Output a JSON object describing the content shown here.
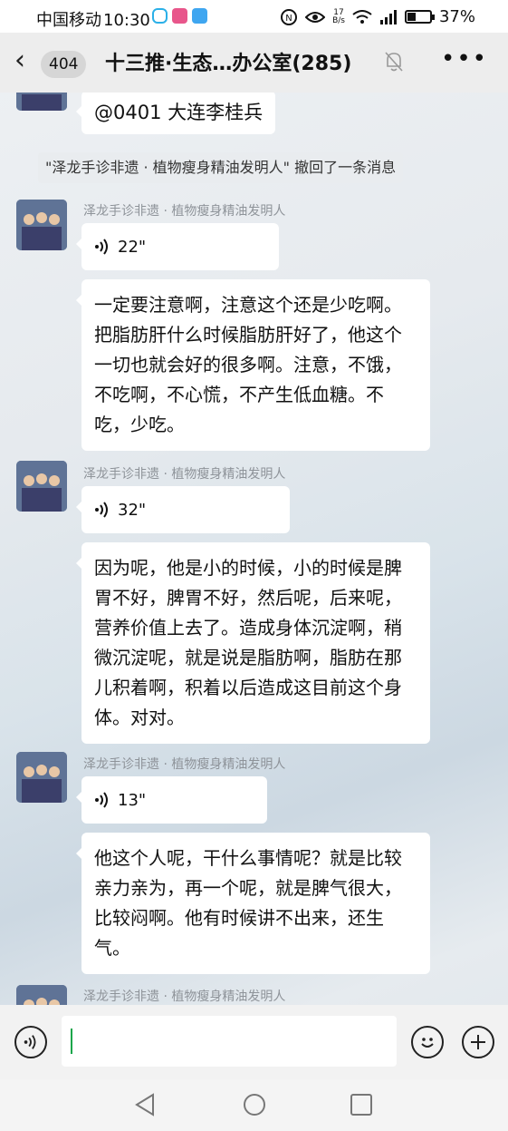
{
  "status": {
    "carrier": "中国移动",
    "time": "10:30",
    "net_speed_top": "17",
    "net_speed_bottom": "B/s",
    "battery": "37%",
    "battery_level": 0.37
  },
  "header": {
    "back_count": "404",
    "title": "十三推·生态…办公室(285)"
  },
  "messages": {
    "mention": "@0401 大连李桂兵",
    "recall_notice": "\"泽龙手诊非遗 · 植物瘦身精油发明人\" 撤回了一条消息",
    "sender": "泽龙手诊非遗 · 植物瘦身精油发明人",
    "group1": {
      "voice_duration": "22\"",
      "transcript": "一定要注意啊，注意这个还是少吃啊。把脂肪肝什么时候脂肪肝好了，他这个一切也就会好的很多啊。注意，不饿，不吃啊，不心慌，不产生低血糖。不吃，少吃。"
    },
    "group2": {
      "voice_duration": "32\"",
      "transcript": "因为呢，他是小的时候，小的时候是脾胃不好，脾胃不好，然后呢，后来呢，营养价值上去了。造成身体沉淀啊，稍微沉淀呢，就是说是脂肪啊，脂肪在那儿积着啊，积着以后造成这目前这个身体。对对。"
    },
    "group3": {
      "voice_duration": "13\"",
      "transcript": "他这个人呢，干什么事情呢？就是比较亲力亲为，再一个呢，就是脾气很大，比较闷啊。他有时候讲不出来，还生气。"
    }
  },
  "icons": {
    "back": "chevron-left-icon",
    "mute": "bell-off-icon",
    "more": "more-dots-icon",
    "voice": "voice-wave-icon",
    "emoji": "smiley-icon",
    "plus": "plus-icon",
    "nav_back": "triangle-back-icon",
    "nav_home": "circle-home-icon",
    "nav_recent": "square-recent-icon"
  }
}
